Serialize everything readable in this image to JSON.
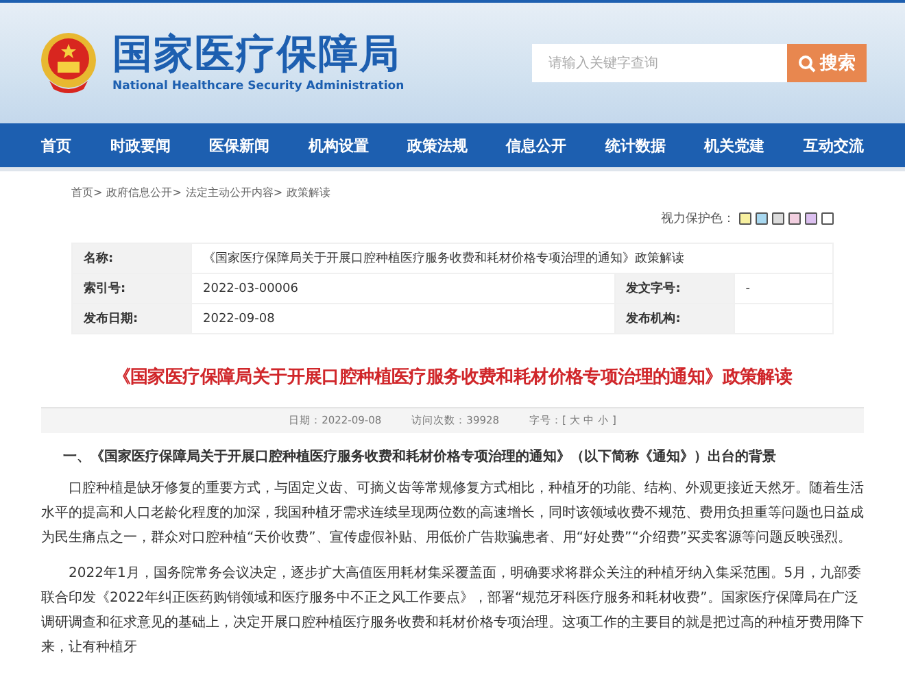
{
  "header": {
    "title": "国家医疗保障局",
    "subtitle": "National Healthcare Security Administration",
    "search": {
      "placeholder": "请输入关键字查询",
      "button": "搜索"
    }
  },
  "nav": {
    "items": [
      "首页",
      "时政要闻",
      "医保新闻",
      "机构设置",
      "政策法规",
      "信息公开",
      "统计数据",
      "机关党建",
      "互动交流"
    ]
  },
  "breadcrumb": [
    "首页>",
    "政府信息公开>",
    "法定主动公开内容>",
    "政策解读"
  ],
  "eye_care": {
    "label": "视力保护色：",
    "swatches": [
      {
        "color": "#f7f0a0"
      },
      {
        "color": "#a8d8f0"
      },
      {
        "color": "#dcdcdc"
      },
      {
        "color": "#f2cfe0"
      },
      {
        "color": "#dcc0f0"
      },
      {
        "color": "#ffffff"
      }
    ]
  },
  "info_table": {
    "name_label": "名称:",
    "name_value": "《国家医疗保障局关于开展口腔种植医疗服务收费和耗材价格专项治理的通知》政策解读",
    "rows": [
      {
        "label_1": "索引号:",
        "value_1": "2022-03-00006",
        "label_2": "发文字号:",
        "value_2": "-"
      },
      {
        "label_1": "发布日期:",
        "value_1": "2022-09-08",
        "label_2": "发布机构:",
        "value_2": ""
      }
    ]
  },
  "article": {
    "title": "《国家医疗保障局关于开展口腔种植医疗服务收费和耗材价格专项治理的通知》政策解读",
    "meta": [
      "日期：2022-09-08",
      "访问次数：39928",
      "字号：[ 大 中 小 ]"
    ],
    "heading": "一、《国家医疗保障局关于开展口腔种植医疗服务收费和耗材价格专项治理的通知》（以下简称《通知》）出台的背景",
    "paragraphs": [
      "口腔种植是缺牙修复的重要方式，与固定义齿、可摘义齿等常规修复方式相比，种植牙的功能、结构、外观更接近天然牙。随着生活水平的提高和人口老龄化程度的加深，我国种植牙需求连续呈现两位数的高速增长，同时该领域收费不规范、费用负担重等问题也日益成为民生痛点之一，群众对口腔种植“天价收费”、宣传虚假补贴、用低价广告欺骗患者、用“好处费”“介绍费”买卖客源等问题反映强烈。",
      "2022年1月，国务院常务会议决定，逐步扩大高值医用耗材集采覆盖面，明确要求将群众关注的种植牙纳入集采范围。5月，九部委联合印发《2022年纠正医药购销领域和医疗服务中不正之风工作要点》，部署“规范牙科医疗服务和耗材收费”。国家医疗保障局在广泛调研调查和征求意见的基础上，决定开展口腔种植医疗服务收费和耗材价格专项治理。这项工作的主要目的就是把过高的种植牙费用降下来，让有种植牙"
    ]
  }
}
